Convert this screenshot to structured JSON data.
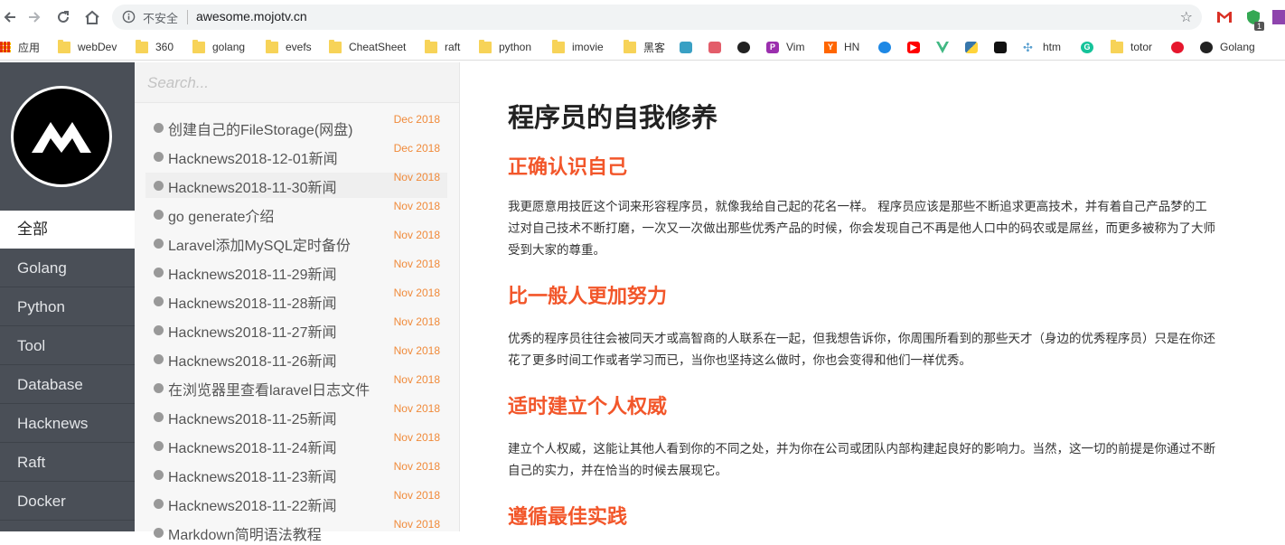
{
  "browser": {
    "security_label": "不安全",
    "url": "awesome.mojotv.cn",
    "extension_badge": "1"
  },
  "bookmarks": [
    {
      "label": "应用",
      "icon": "apps-grid-icon"
    },
    {
      "label": "webDev",
      "icon": "folder-icon"
    },
    {
      "label": "360",
      "icon": "folder-icon"
    },
    {
      "label": "golang",
      "icon": "folder-icon"
    },
    {
      "label": "evefs",
      "icon": "folder-icon"
    },
    {
      "label": "CheatSheet",
      "icon": "folder-icon"
    },
    {
      "label": "raft",
      "icon": "folder-icon"
    },
    {
      "label": "python",
      "icon": "folder-icon"
    },
    {
      "label": "imovie",
      "icon": "folder-icon"
    },
    {
      "label": "黑客",
      "icon": "folder-icon"
    },
    {
      "label": "",
      "icon": "site-icon"
    },
    {
      "label": "",
      "icon": "site-icon"
    },
    {
      "label": "",
      "icon": "github-icon"
    },
    {
      "label": "Vim",
      "icon": "vim-icon"
    },
    {
      "label": "HN",
      "icon": "hackernews-icon"
    },
    {
      "label": "",
      "icon": "site-icon"
    },
    {
      "label": "",
      "icon": "youtube-icon"
    },
    {
      "label": "",
      "icon": "vue-icon"
    },
    {
      "label": "",
      "icon": "python-icon"
    },
    {
      "label": "",
      "icon": "site-icon"
    },
    {
      "label": "htm",
      "icon": "site-icon"
    },
    {
      "label": "",
      "icon": "grammarly-icon"
    },
    {
      "label": "totor",
      "icon": "folder-icon"
    },
    {
      "label": "",
      "icon": "weibo-icon"
    },
    {
      "label": "Golang",
      "icon": "github-icon"
    }
  ],
  "sidebar": {
    "categories": [
      "全部",
      "Golang",
      "Python",
      "Tool",
      "Database",
      "Hacknews",
      "Raft",
      "Docker"
    ],
    "active_index": 0
  },
  "search": {
    "placeholder": "Search..."
  },
  "posts": [
    {
      "title": "创建自己的FileStorage(网盘)",
      "date": "Dec 2018"
    },
    {
      "title": "Hacknews2018-12-01新闻",
      "date": "Dec 2018"
    },
    {
      "title": "Hacknews2018-11-30新闻",
      "date": "Nov 2018"
    },
    {
      "title": "go generate介绍",
      "date": "Nov 2018"
    },
    {
      "title": "Laravel添加MySQL定时备份",
      "date": "Nov 2018"
    },
    {
      "title": "Hacknews2018-11-29新闻",
      "date": "Nov 2018"
    },
    {
      "title": "Hacknews2018-11-28新闻",
      "date": "Nov 2018"
    },
    {
      "title": "Hacknews2018-11-27新闻",
      "date": "Nov 2018"
    },
    {
      "title": "Hacknews2018-11-26新闻",
      "date": "Nov 2018"
    },
    {
      "title": "在浏览器里查看laravel日志文件",
      "date": "Nov 2018"
    },
    {
      "title": "Hacknews2018-11-25新闻",
      "date": "Nov 2018"
    },
    {
      "title": "Hacknews2018-11-24新闻",
      "date": "Nov 2018"
    },
    {
      "title": "Hacknews2018-11-23新闻",
      "date": "Nov 2018"
    },
    {
      "title": "Hacknews2018-11-22新闻",
      "date": "Nov 2018"
    },
    {
      "title": "Markdown简明语法教程",
      "date": "Nov 2018"
    }
  ],
  "article": {
    "title": "程序员的自我修养",
    "sections": [
      {
        "heading": "正确认识自己",
        "lines": [
          "我更愿意用技匠这个词来形容程序员，就像我给自己起的花名一样。 程序员应该是那些不断追求更高技术，并有着自己产品梦的工",
          "过对自己技术不断打磨，一次又一次做出那些优秀产品的时候，你会发现自己不再是他人口中的码农或是屌丝，而更多被称为了大师",
          "受到大家的尊重。"
        ]
      },
      {
        "heading": "比一般人更加努力",
        "lines": [
          "优秀的程序员往往会被同天才或高智商的人联系在一起，但我想告诉你，你周围所看到的那些天才（身边的优秀程序员）只是在你还",
          "花了更多时间工作或者学习而已，当你也坚持这么做时，你也会变得和他们一样优秀。"
        ]
      },
      {
        "heading": "适时建立个人权威",
        "lines": [
          "建立个人权威，这能让其他人看到你的不同之处，并为你在公司或团队内部构建起良好的影响力。当然，这一切的前提是你通过不断",
          "自己的实力，并在恰当的时候去展现它。"
        ]
      },
      {
        "heading": "遵循最佳实践",
        "lines": []
      }
    ]
  },
  "colors": {
    "accent": "#f2562a",
    "sidebar": "#4a4f57",
    "date": "#f08a3a"
  }
}
